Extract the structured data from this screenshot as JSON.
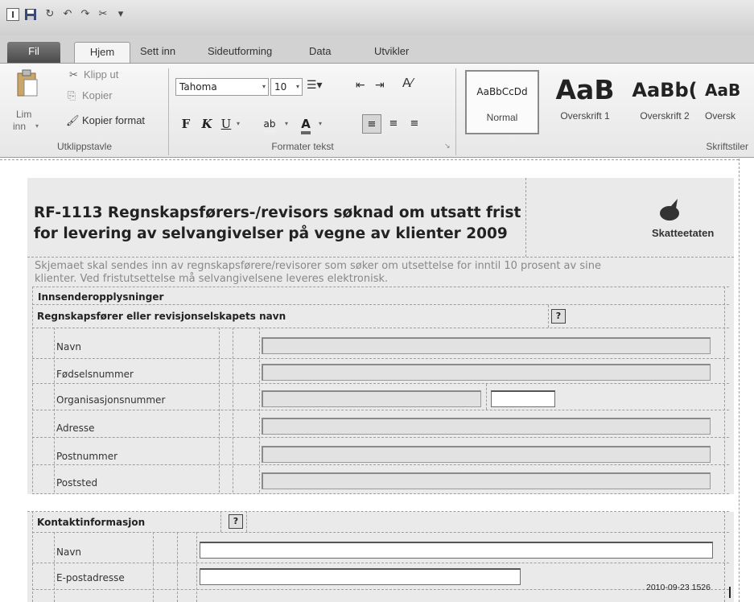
{
  "qat": {
    "icons": [
      "app-icon",
      "save-icon",
      "redo-icon",
      "undo-icon",
      "repeat-icon",
      "format-painter-icon",
      "customize-icon"
    ]
  },
  "tabs": {
    "file": "Fil",
    "home": "Hjem",
    "insert": "Sett inn",
    "layout": "Sideutforming",
    "data": "Data",
    "developer": "Utvikler"
  },
  "ribbon": {
    "clipboard": {
      "paste": "Lim",
      "paste2": "inn",
      "cut": "Klipp ut",
      "copy": "Kopier",
      "format_painter": "Kopier format",
      "group_label": "Utklippstavle"
    },
    "font": {
      "family": "Tahoma",
      "size": "10",
      "bold": "F",
      "italic": "K",
      "underline": "U",
      "group_label": "Formater tekst"
    },
    "styles": {
      "items": [
        {
          "sample": "AaBbCcDd",
          "name": "Normal"
        },
        {
          "sample": "AaB",
          "name": "Overskrift 1"
        },
        {
          "sample": "AaBb(",
          "name": "Overskrift 2"
        },
        {
          "sample": "AaB",
          "name": "Oversk"
        }
      ],
      "group_label": "Skriftstiler"
    }
  },
  "form": {
    "title_line1": "RF-1113 Regnskapsførers-/revisors søknad om utsatt frist",
    "title_line2": "for levering av selvangivelser på vegne av klienter 2009",
    "brand": "Skatteetaten",
    "intro_line1": "Skjemaet skal sendes inn av regnskapsførere/revisorer som søker om utsettelse for inntil 10 prosent av sine",
    "intro_line2": "klienter. Ved fristutsettelse må selvangivelsene leveres elektronisk.",
    "section1": "Innsenderopplysninger",
    "subsection1": "Regnskapsfører eller revisjonselskapets navn",
    "help": "?",
    "fields1": [
      "Navn",
      "Fødselsnummer",
      "Organisasjonsnummer",
      "Adresse",
      "Postnummer",
      "Poststed"
    ],
    "section2": "Kontaktinformasjon",
    "fields2": [
      "Navn",
      "E-postadresse"
    ]
  },
  "status": {
    "text": "2010-09-23 1526"
  }
}
